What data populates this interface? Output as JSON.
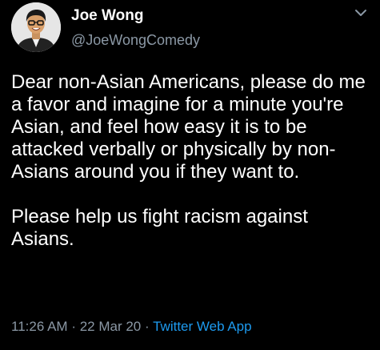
{
  "author": {
    "display_name": "Joe Wong",
    "handle": "@JoeWongComedy",
    "avatar_icon": "person-portrait"
  },
  "more_icon": "chevron-down-icon",
  "tweet": {
    "paragraphs": [
      "Dear non-Asian Americans, please do me a favor and imagine for a minute you're Asian, and feel how easy it is to be attacked verbally or physically by non-Asians around you if they want to.",
      "Please help us fight racism against Asians."
    ]
  },
  "meta": {
    "time": "11:26 AM",
    "separator": "·",
    "date": "22 Mar 20",
    "source": "Twitter Web App"
  },
  "colors": {
    "background": "#000000",
    "text": "#ffffff",
    "secondary": "#8b98a5",
    "link": "#1d9bf0"
  }
}
